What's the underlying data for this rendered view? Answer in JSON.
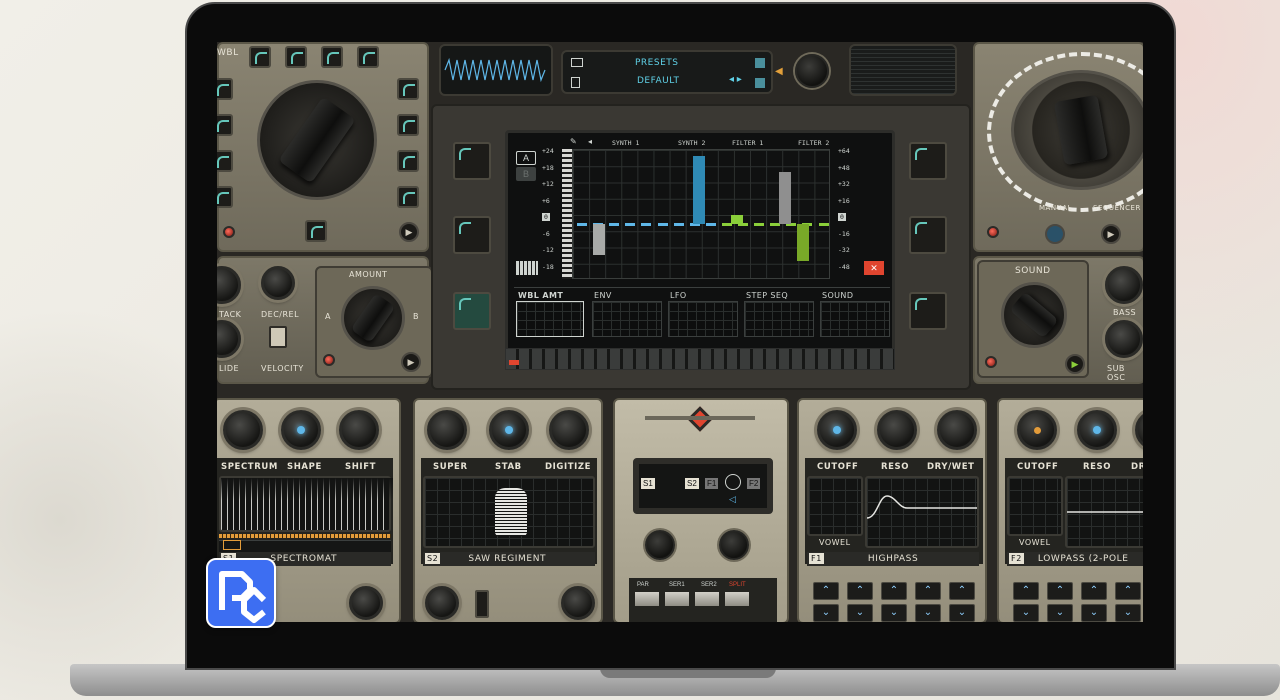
{
  "header": {
    "brand": "WBL",
    "presets_label": "PRESETS",
    "preset_name": "DEFAULT"
  },
  "left": {
    "amount_label": "AMOUNT",
    "knob_labels": [
      "TACK",
      "DEC/REL",
      "LIDE",
      "VELOCITY"
    ],
    "knob_ab": [
      "A",
      "B"
    ]
  },
  "right": {
    "manual_label": "MANUAL",
    "sequencer_label": "SEQUENCER",
    "sound_label": "SOUND",
    "bass_label": "BASS",
    "sub_osc_label": "SUB OSC"
  },
  "display": {
    "routing": [
      "SYNTH 1",
      "SYNTH 2",
      "FILTER 1",
      "FILTER 2"
    ],
    "left_scale": [
      "+24",
      "+18",
      "+12",
      "+6",
      "0",
      "-6",
      "-12",
      "-18"
    ],
    "right_scale": [
      "+64",
      "+48",
      "+32",
      "+16",
      "0",
      "-16",
      "-32",
      "-48"
    ],
    "ab": [
      "A",
      "B"
    ],
    "tabs": [
      "WBL AMT",
      "ENV",
      "LFO",
      "STEP SEQ",
      "SOUND"
    ],
    "bars": [
      {
        "value": -10,
        "color": "#a8aaa8"
      },
      {
        "value": 22,
        "color": "#2f8ab5"
      },
      {
        "value": 3,
        "color": "#8bcf3a"
      },
      {
        "value": 17,
        "color": "#8f8f8f"
      },
      {
        "value": -12,
        "color": "#79a928"
      }
    ]
  },
  "modules": [
    {
      "tag": "S1",
      "name": "SPECTROMAT",
      "params": [
        "SPECTRUM",
        "SHAPE",
        "SHIFT"
      ]
    },
    {
      "tag": "S2",
      "name": "SAW REGIMENT",
      "params": [
        "SUPER",
        "STAB",
        "DIGITIZE"
      ]
    },
    {
      "tag": "F1",
      "name": "HIGHPASS",
      "params": [
        "CUTOFF",
        "RESO",
        "DRY/WET"
      ],
      "sub": "VOWEL"
    },
    {
      "tag": "F2",
      "name": "LOWPASS (2-POLE",
      "params": [
        "CUTOFF",
        "RESO",
        "DR"
      ],
      "sub": "VOWEL"
    }
  ],
  "routing_panel": {
    "nodes": [
      "S1",
      "S2",
      "F1",
      "F2"
    ],
    "buttons": [
      "PAR",
      "SER1",
      "SER2",
      "SPLIT"
    ],
    "active": "SPLIT",
    "accent": "#e0452f"
  },
  "colors": {
    "blue": "#5fb7e8",
    "green": "#8bcf3a",
    "teal": "#66c7bb"
  }
}
